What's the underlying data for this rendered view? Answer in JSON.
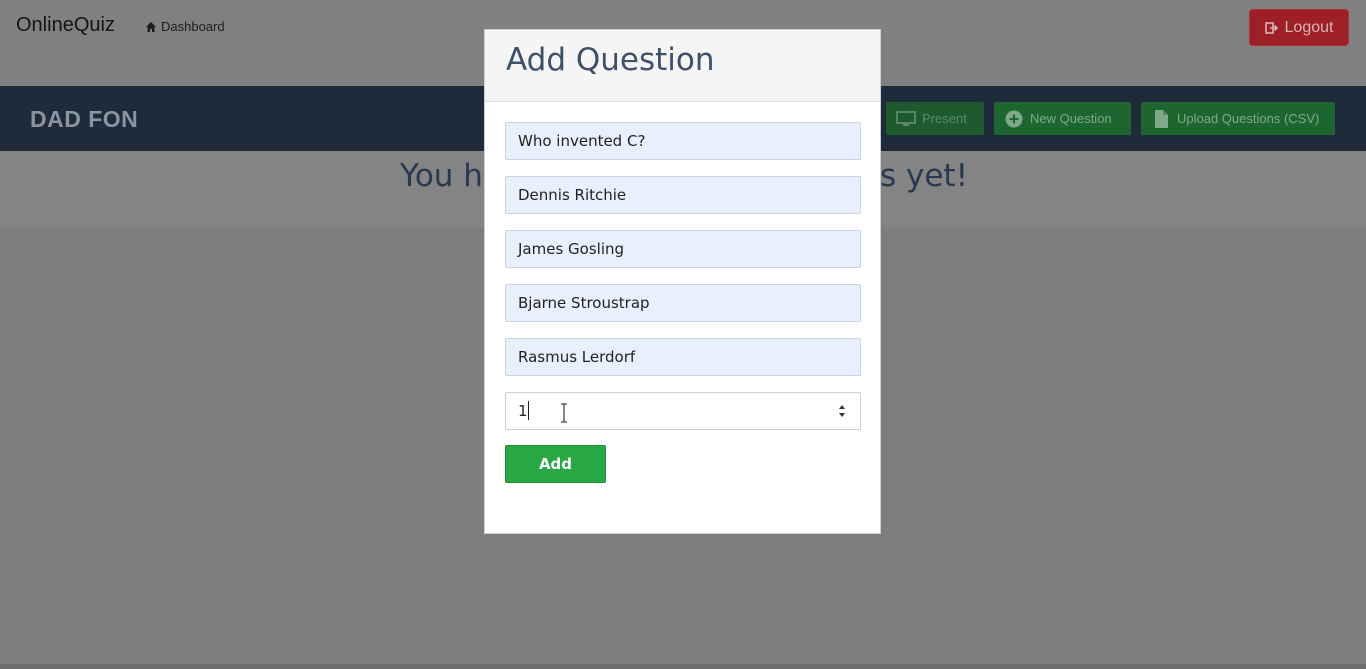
{
  "navbar": {
    "brand": "OnlineQuiz",
    "dashboard_label": "Dashboard",
    "dashboard_icon": "home-icon",
    "logout_label": "Logout",
    "logout_icon": "sign-out-icon"
  },
  "quiz_header": {
    "title": "DAD FON",
    "buttons": [
      {
        "label": "Present",
        "icon": "monitor-icon"
      },
      {
        "label": "New Question",
        "icon": "plus-circle-icon"
      },
      {
        "label": "Upload Questions (CSV)",
        "icon": "file-icon"
      }
    ]
  },
  "main": {
    "empty_message_left": "You h",
    "empty_message_right": "s yet!"
  },
  "modal": {
    "title": "Add Question",
    "fields": [
      {
        "value": "Who invented C?"
      },
      {
        "value": "Dennis Ritchie"
      },
      {
        "value": "James Gosling"
      },
      {
        "value": "Bjarne Stroustrap"
      },
      {
        "value": "Rasmus Lerdorf"
      }
    ],
    "answer_number": "1",
    "add_label": "Add"
  },
  "colors": {
    "accent_green": "#28a745",
    "danger_red": "#9e1f25",
    "header_navy": "#1f2b3a",
    "overlay_gray": "#7e7e7e"
  }
}
